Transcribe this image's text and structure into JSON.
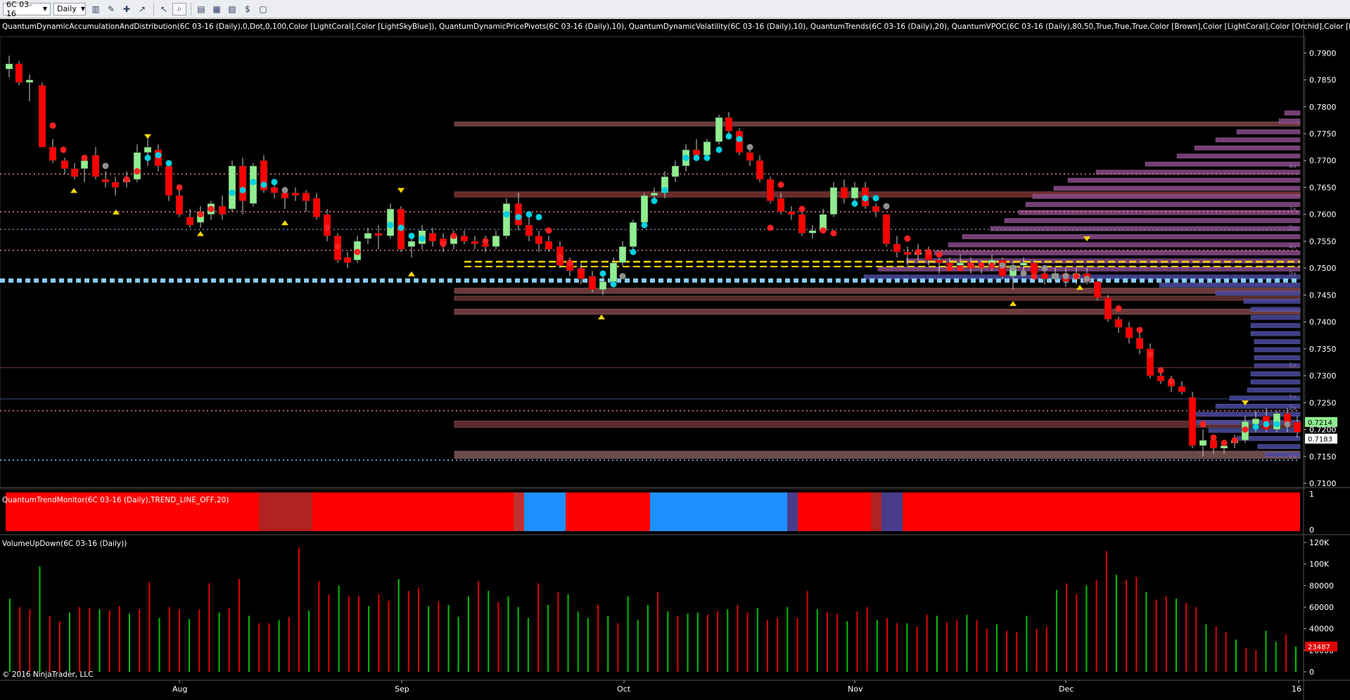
{
  "toolbar": {
    "instrument": "6C 03-16",
    "period": "Daily",
    "icons": [
      "bar-type-icon",
      "draw-pencil-icon",
      "add-indicator-icon",
      "strategy-icon",
      "cursor-icon",
      "zoom-icon",
      "data-box-icon",
      "chart-properties-icon",
      "time-frame-icon",
      "money-icon",
      "window-icon"
    ]
  },
  "panels": {
    "price_label": "QuantumDynamicAccumulationAndDistribution(6C 03-16 (Daily),0,Dot,0,100,Color [LightCoral],Color [LightSkyBlue]), QuantumDynamicPricePivots(6C 03-16 (Daily),10), QuantumDynamicVolatility(6C 03-16 (Daily),10), QuantumTrends(6C 03-16 (Daily),20), QuantumVPOC(6C 03-16 (Daily),80,50,True,True,True,Color [Brown],Color [LightCoral],Color [Orchid],Color [MediumS",
    "trend_label": "QuantumTrendMonitor(6C 03-16 (Daily),TREND_LINE_OFF,20)",
    "volume_label": "VolumeUpDown(6C 03-16 (Daily))",
    "copyright": "© 2016 NinjaTrader, LLC"
  },
  "price_axis": {
    "ticks": [
      "0.7900",
      "0.7850",
      "0.7800",
      "0.7750",
      "0.7700",
      "0.7650",
      "0.7600",
      "0.7550",
      "0.7500",
      "0.7450",
      "0.7400",
      "0.7350",
      "0.7300",
      "0.7250",
      "0.7200",
      "0.7150",
      "0.7100"
    ],
    "tag_current": "0.7214",
    "tag_2": "0.7183"
  },
  "trend_axis": {
    "ticks": [
      "1",
      "0"
    ]
  },
  "volume_axis": {
    "ticks": [
      "120K",
      "100K",
      "80000",
      "60000",
      "40000",
      "20000",
      "0"
    ],
    "tag_current": "23487"
  },
  "date_axis": {
    "labels": [
      "Aug",
      "Sep",
      "Oct",
      "Nov",
      "Dec",
      "16"
    ]
  },
  "vpoc_markers": [
    "4x",
    "3x",
    "2x",
    "4x",
    "9x",
    "1x",
    "1x",
    "2x",
    "2x"
  ],
  "colors": {
    "bull_candle": "#90ee90",
    "bear_candle": "#ff0000",
    "vol_up": "#00c000",
    "vol_down": "#e00000",
    "trend_red": "#ff0000",
    "trend_blue": "#1e90ff",
    "trend_darkred": "#b22222",
    "trend_navy": "#483d8b",
    "resistance_line": "#f08080",
    "support_line": "#87cefa",
    "vpoc_bar": "#9b4f9b",
    "volume_profile": "#a070c0"
  }
}
